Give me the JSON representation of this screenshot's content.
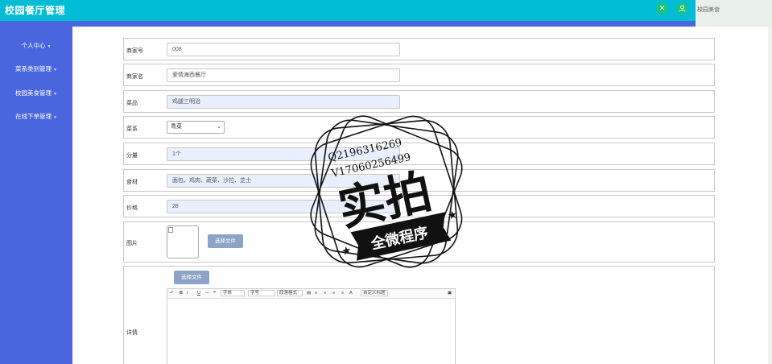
{
  "header": {
    "title": "校园餐厅管理",
    "user_name": "校园美食"
  },
  "sidebar": {
    "items": [
      {
        "label": "个人中心"
      },
      {
        "label": "菜系类别管理"
      },
      {
        "label": "校园美食管理"
      },
      {
        "label": "在线下单管理"
      }
    ]
  },
  "form": {
    "merchant_no": {
      "label": "商家号",
      "value": "008"
    },
    "merchant_name": {
      "label": "商家名",
      "value": "爱情海西餐厅"
    },
    "dish": {
      "label": "菜品",
      "value": "鸡腿三明治"
    },
    "cuisine": {
      "label": "菜系",
      "value": "粤菜"
    },
    "portion": {
      "label": "分量",
      "value": "1个"
    },
    "ingredients": {
      "label": "食材",
      "value": "面包、鸡肉、蔬菜、沙拉、芝士"
    },
    "price": {
      "label": "价格",
      "value": "28"
    },
    "image": {
      "label": "图片",
      "upload_label": "选择文件"
    },
    "details": {
      "label": "详情",
      "upload_label": "选择文件"
    }
  },
  "editor_toolbar": {
    "font_family": "字体",
    "font_size": "字号",
    "paragraph": "段落格式",
    "custom_title": "自定义标题"
  },
  "watermark": {
    "line1": "Q2196316269",
    "line2": "V17060256499",
    "main": "实拍",
    "banner": "全微程序"
  }
}
